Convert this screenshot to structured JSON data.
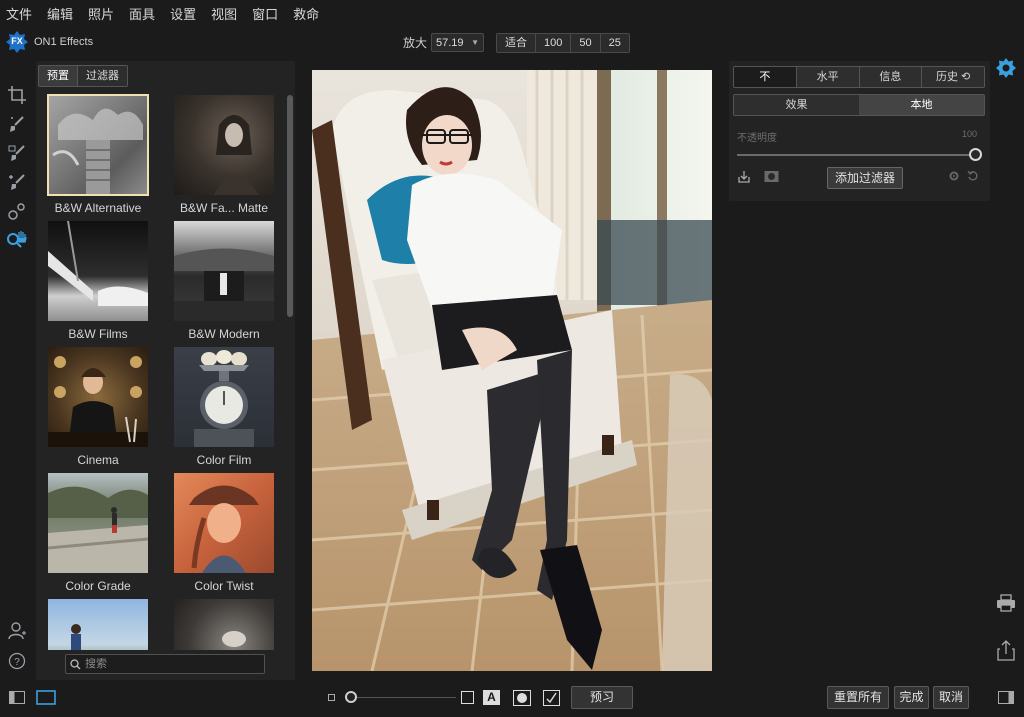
{
  "menu": [
    "文件",
    "编辑",
    "照片",
    "面具",
    "设置",
    "视图",
    "窗口",
    "救命"
  ],
  "brand": {
    "badge": "FX",
    "name": "ON1 Effects"
  },
  "zoom": {
    "label": "放大",
    "value": "57.19",
    "presets": [
      "适合",
      "100",
      "50",
      "25"
    ]
  },
  "browser": {
    "tabs": [
      "预置",
      "过滤器"
    ],
    "presets": [
      {
        "name": "B&W Alternative",
        "selected": true
      },
      {
        "name": "B&W Fa... Matte"
      },
      {
        "name": "B&W Films"
      },
      {
        "name": "B&W Modern"
      },
      {
        "name": "Cinema"
      },
      {
        "name": "Color Film"
      },
      {
        "name": "Color Grade"
      },
      {
        "name": "Color Twist"
      },
      {
        "name": ""
      },
      {
        "name": ""
      }
    ],
    "search_placeholder": "搜索"
  },
  "right_panel": {
    "view_tabs": [
      "不",
      "水平",
      "信息",
      "历史"
    ],
    "mode_tabs": [
      "效果",
      "本地"
    ],
    "opacity_label": "不透明度",
    "opacity_value": "100",
    "add_filter": "添加过滤器"
  },
  "bottom": {
    "preview": "预习",
    "reset_all": "重置所有",
    "done": "完成",
    "cancel": "取消",
    "text_overlay_glyph": "A"
  },
  "colors": {
    "accent": "#3aa0e0",
    "badge": "#1e73c8",
    "selection": "#efe2b0"
  },
  "icons": [
    "crop-icon",
    "brush-icon",
    "masking-brush-icon",
    "refine-brush-icon",
    "retouch-icon",
    "zoom-hand-icon",
    "user-icon",
    "help-icon",
    "sun-badge-icon",
    "print-icon",
    "share-icon"
  ]
}
